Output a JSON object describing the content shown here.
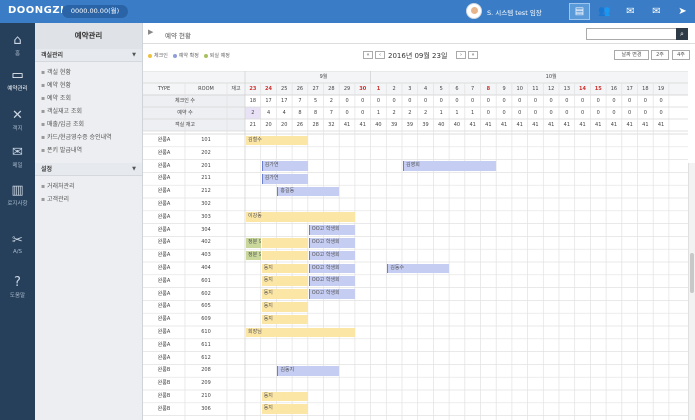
{
  "app": {
    "logo": "DOONGZI",
    "balance": "0000.00.00(월)",
    "user": "S. 시스템 test 임장"
  },
  "topicons": [
    {
      "name": "chart-icon",
      "glyph": "▤",
      "active": true
    },
    {
      "name": "users-icon",
      "glyph": "👥",
      "active": false
    },
    {
      "name": "envelope-x-icon",
      "glyph": "✉",
      "active": false
    },
    {
      "name": "mail-icon",
      "glyph": "✉",
      "active": false
    },
    {
      "name": "arrow-icon",
      "glyph": "➤",
      "active": false
    }
  ],
  "nav": [
    {
      "label": "홈",
      "icon": "home-icon",
      "glyph": "⌂"
    },
    {
      "label": "예약관리",
      "icon": "monitor-icon",
      "glyph": "▭",
      "active": true
    },
    {
      "label": "객지",
      "icon": "tools-icon",
      "glyph": "✕"
    },
    {
      "label": "메일",
      "icon": "mail-icon",
      "glyph": "✉"
    },
    {
      "label": "로지사항",
      "icon": "chart-icon",
      "glyph": "▥"
    },
    {
      "label": "A/S",
      "icon": "wrench-icon",
      "glyph": "✂"
    },
    {
      "label": "도움말",
      "icon": "help-icon",
      "glyph": "?"
    }
  ],
  "side": {
    "title": "예약관리",
    "sections": [
      {
        "title": "객실관리",
        "items": [
          "객실 현황",
          "예약 현황",
          "예약 조회",
          "객실재고 조회",
          "매출/입금 조회",
          "카드/현금영수증 승인내역",
          "폰키 발급내역"
        ]
      },
      {
        "title": "설정",
        "items": [
          "거래처관리",
          "고객관리"
        ]
      }
    ]
  },
  "page": {
    "title": "예약 현황",
    "date": "2016년 09월 23일",
    "change_btn": "날짜 변경",
    "sel1": "2주",
    "sel2": "4주",
    "legend": [
      {
        "label": "체크인",
        "color": "#f0c040"
      },
      {
        "label": "예약 확정",
        "color": "#8e9ed8"
      },
      {
        "label": "퇴실 예정",
        "color": "#a8c060"
      }
    ]
  },
  "grid": {
    "month_sep": "9월",
    "month_oct": "10월",
    "hdr_type": "TYPE",
    "hdr_room": "ROOM",
    "hdr_stock": "재고",
    "days": [
      "23",
      "24",
      "25",
      "26",
      "27",
      "28",
      "29",
      "30",
      "1",
      "2",
      "3",
      "4",
      "5",
      "6",
      "7",
      "8",
      "9",
      "10",
      "11",
      "12",
      "13",
      "14",
      "15",
      "16",
      "17",
      "18",
      "19"
    ],
    "red_days": [
      0,
      1,
      7,
      8,
      15,
      21,
      22
    ],
    "sum_rows": [
      {
        "label": "체크인 수",
        "stock": "",
        "vals": [
          "18",
          "17",
          "17",
          "7",
          "5",
          "2",
          "0",
          "0",
          "0",
          "0",
          "0",
          "0",
          "0",
          "0",
          "0",
          "0",
          "0",
          "0",
          "0",
          "0",
          "0",
          "0",
          "0",
          "0",
          "0",
          "0",
          "0"
        ]
      },
      {
        "label": "예약 수",
        "stock": "",
        "vals": [
          "2",
          "4",
          "4",
          "8",
          "8",
          "7",
          "0",
          "0",
          "1",
          "2",
          "2",
          "2",
          "1",
          "1",
          "1",
          "0",
          "0",
          "0",
          "0",
          "0",
          "0",
          "0",
          "0",
          "0",
          "0",
          "0",
          "0"
        ]
      },
      {
        "label": "객실 재고",
        "stock": "",
        "vals": [
          "21",
          "20",
          "20",
          "26",
          "28",
          "32",
          "41",
          "41",
          "40",
          "39",
          "39",
          "39",
          "40",
          "40",
          "41",
          "41",
          "41",
          "41",
          "41",
          "41",
          "41",
          "41",
          "41",
          "41",
          "41",
          "41",
          "41"
        ]
      }
    ],
    "rows": [
      {
        "type": "완룸A",
        "room": "101"
      },
      {
        "type": "완룸A",
        "room": "202"
      },
      {
        "type": "완룸A",
        "room": "201"
      },
      {
        "type": "완룸A",
        "room": "211"
      },
      {
        "type": "완룸A",
        "room": "212"
      },
      {
        "type": "완룸A",
        "room": "302"
      },
      {
        "type": "완룸A",
        "room": "303"
      },
      {
        "type": "완룸A",
        "room": "304"
      },
      {
        "type": "완룸A",
        "room": "402"
      },
      {
        "type": "완룸A",
        "room": "403"
      },
      {
        "type": "완룸A",
        "room": "404"
      },
      {
        "type": "완룸A",
        "room": "601"
      },
      {
        "type": "완룸A",
        "room": "602"
      },
      {
        "type": "완룸A",
        "room": "605"
      },
      {
        "type": "완룸A",
        "room": "609"
      },
      {
        "type": "완룸A",
        "room": "610"
      },
      {
        "type": "완룸A",
        "room": "611"
      },
      {
        "type": "완룸A",
        "room": "612"
      },
      {
        "type": "완룸B",
        "room": "208"
      },
      {
        "type": "완룸B",
        "room": "209"
      },
      {
        "type": "완룸B",
        "room": "210"
      },
      {
        "type": "완룸B",
        "room": "306"
      }
    ],
    "bars": [
      {
        "row": 0,
        "start": 0,
        "len": 4,
        "label": "김철수",
        "kind": "checkin"
      },
      {
        "row": 2,
        "start": 1,
        "len": 3,
        "label": "김가연",
        "kind": "confirm"
      },
      {
        "row": 2,
        "start": 10,
        "len": 6,
        "label": "김영희",
        "kind": "confirm"
      },
      {
        "row": 3,
        "start": 1,
        "len": 3,
        "label": "김가연",
        "kind": "confirm"
      },
      {
        "row": 4,
        "start": 2,
        "len": 4,
        "label": "홍길동",
        "kind": "confirm"
      },
      {
        "row": 6,
        "start": 0,
        "len": 7,
        "label": "이강동",
        "kind": "checkin"
      },
      {
        "row": 7,
        "start": 4,
        "len": 3,
        "label": "OO고 학생회",
        "kind": "confirm"
      },
      {
        "row": 8,
        "start": 0,
        "len": 1,
        "label": "정분 도",
        "kind": "out"
      },
      {
        "row": 8,
        "start": 1,
        "len": 3,
        "label": "",
        "kind": "checkin"
      },
      {
        "row": 8,
        "start": 4,
        "len": 3,
        "label": "OO고 학생회",
        "kind": "confirm"
      },
      {
        "row": 9,
        "start": 0,
        "len": 1,
        "label": "정분 도",
        "kind": "out"
      },
      {
        "row": 9,
        "start": 1,
        "len": 3,
        "label": "",
        "kind": "checkin"
      },
      {
        "row": 9,
        "start": 4,
        "len": 3,
        "label": "OO고 학생회",
        "kind": "confirm"
      },
      {
        "row": 10,
        "start": 1,
        "len": 3,
        "label": "동지",
        "kind": "checkin"
      },
      {
        "row": 10,
        "start": 4,
        "len": 3,
        "label": "OO고 학생회",
        "kind": "confirm"
      },
      {
        "row": 10,
        "start": 9,
        "len": 4,
        "label": "김동수",
        "kind": "confirm"
      },
      {
        "row": 11,
        "start": 1,
        "len": 3,
        "label": "동지",
        "kind": "checkin"
      },
      {
        "row": 11,
        "start": 4,
        "len": 3,
        "label": "OO고 학생회",
        "kind": "confirm"
      },
      {
        "row": 12,
        "start": 1,
        "len": 3,
        "label": "동지",
        "kind": "checkin"
      },
      {
        "row": 12,
        "start": 4,
        "len": 3,
        "label": "OO고 학생회",
        "kind": "confirm"
      },
      {
        "row": 13,
        "start": 1,
        "len": 3,
        "label": "동지",
        "kind": "checkin"
      },
      {
        "row": 14,
        "start": 1,
        "len": 3,
        "label": "동지",
        "kind": "checkin"
      },
      {
        "row": 15,
        "start": 0,
        "len": 7,
        "label": "회장님",
        "kind": "checkin"
      },
      {
        "row": 18,
        "start": 2,
        "len": 4,
        "label": "김동지",
        "kind": "confirm"
      },
      {
        "row": 20,
        "start": 1,
        "len": 3,
        "label": "동지",
        "kind": "checkin"
      },
      {
        "row": 21,
        "start": 1,
        "len": 3,
        "label": "동지",
        "kind": "checkin"
      }
    ]
  },
  "colors": {
    "checkin": "#fbe6a6",
    "confirm": "#c5cdf3",
    "out": "#c9d79a",
    "red": "#d0312d"
  }
}
